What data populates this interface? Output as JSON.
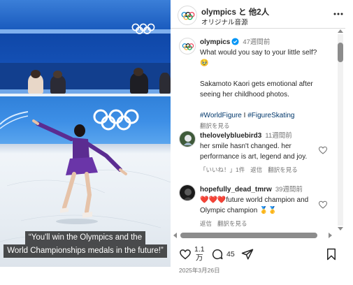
{
  "video": {
    "caption_line1": "“You'll win the Olympics and the",
    "caption_line2": "World Championships medals in the future!”"
  },
  "header": {
    "title": "olympics と 他2人",
    "subtitle": "オリジナル音源",
    "more_icon": "more-options-icon"
  },
  "caption_post": {
    "username": "olympics",
    "time": "47週間前",
    "line1": "What would you say to your little self?",
    "emoji": "🥹",
    "line2": "Sakamoto Kaori gets emotional after seeing her childhood photos.",
    "hashtag1": "#WorldFigure",
    "separator": " I ",
    "hashtag2": "#FigureSkating",
    "translate": "翻訳を見る"
  },
  "comments": [
    {
      "username": "thelovelybluebird3",
      "time": "11週間前",
      "text": "her smile hasn't changed. her performance is art, legend and joy.",
      "likes": "「いいね！」1件",
      "reply": "返信",
      "translate": "翻訳を見る"
    },
    {
      "username": "hopefully_dead_tmrw",
      "time": "39週間前",
      "text": "❤️❤️❤️future world champion and Olympic champion 🥇🥇",
      "reply": "返信",
      "translate": "翻訳を見る"
    }
  ],
  "actions": {
    "like_count_line1": "1.1",
    "like_count_line2": "万",
    "comment_count": "45",
    "date": "2025年3月26日"
  },
  "colors": {
    "link": "#00376b",
    "verified": "#0095f6",
    "muted": "#737373",
    "rink_blue": "#1552b8"
  }
}
